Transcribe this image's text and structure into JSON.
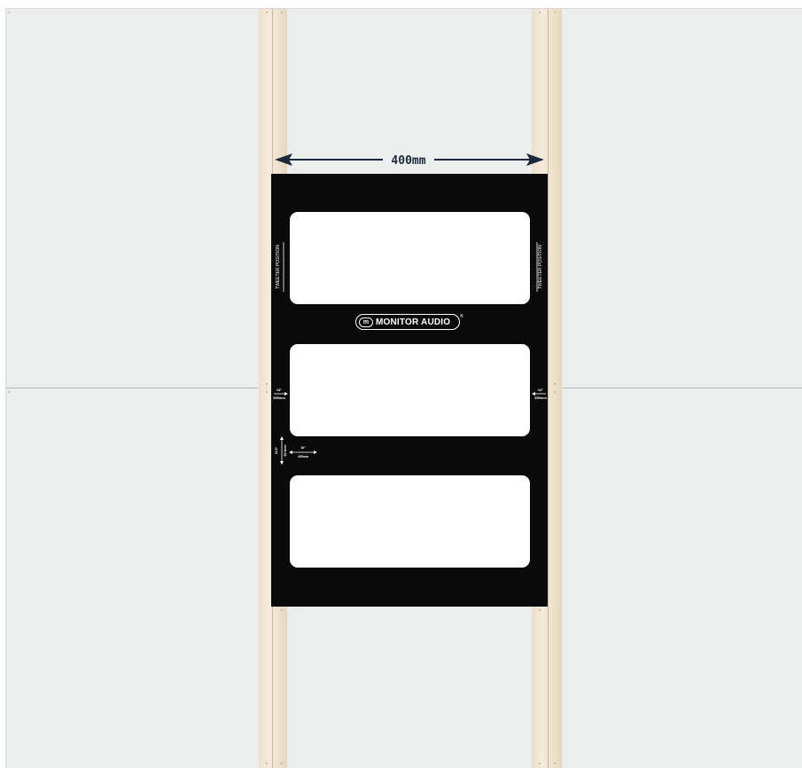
{
  "diagram": {
    "width_dimension": "400mm",
    "brand_name": "MONITOR AUDIO",
    "tweeter_label": "TWEETER POSITION",
    "side_dim_inches": "14\"",
    "side_dim_mm": "355mm",
    "spacing_vertical_inches": "22.5\"",
    "spacing_vertical_mm": "63.5mm",
    "spacing_horizontal_inches": "16\"",
    "spacing_horizontal_mm": "405mm"
  },
  "colors": {
    "drywall": "#eceeee",
    "stud": "#f2e7d5",
    "template": "#0a0a0a",
    "cutout": "#ffffff",
    "dimension_line": "#1b2a3a"
  }
}
